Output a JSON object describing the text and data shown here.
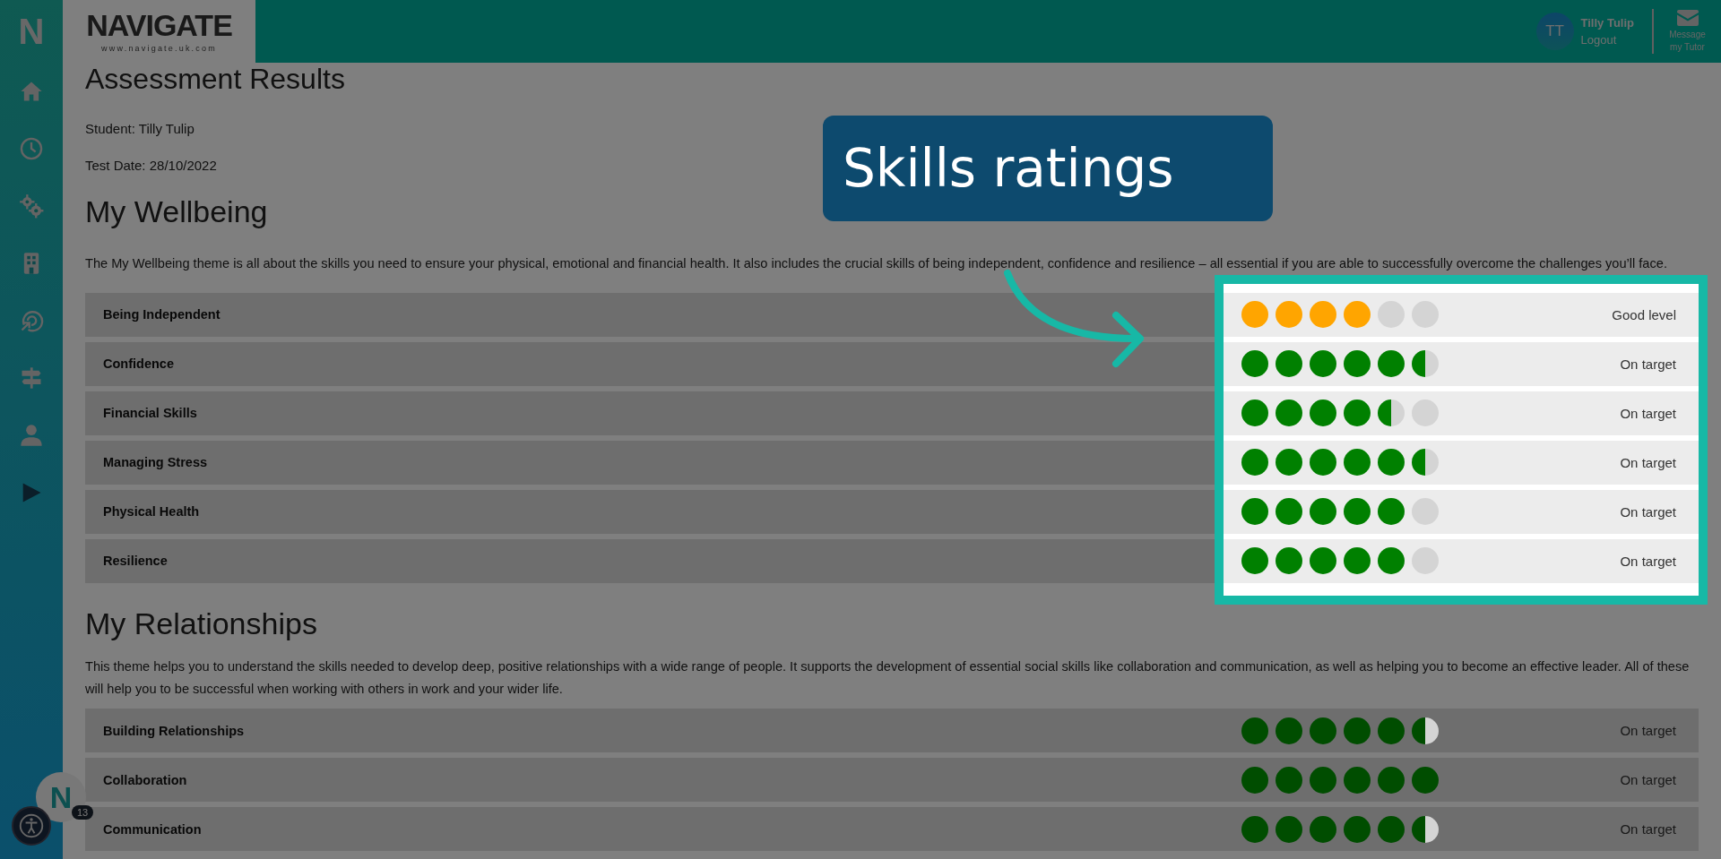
{
  "header": {
    "logo_mark": "N",
    "logo": "NAVIGATE",
    "logo_url": "www.navigate.uk.com",
    "user": {
      "initials": "TT",
      "name": "Tilly Tulip",
      "logout": "Logout"
    },
    "message_button": "Message my Tutor"
  },
  "page": {
    "title": "Assessment Results",
    "student": "Student: Tilly Tulip",
    "test_date": "Test Date: 28/10/2022"
  },
  "sections": [
    {
      "title": "My Wellbeing",
      "description": "The My Wellbeing theme is all about the skills you need to ensure your physical, emotional and financial health. It also includes the crucial skills of being independent, confidence and resilience – all essential if you are able to successfully overcome the challenges you’ll face.",
      "highlighted": true,
      "skills": [
        {
          "name": "Being Independent",
          "stars": 4,
          "color": "#ffa500",
          "status": "Good level"
        },
        {
          "name": "Confidence",
          "stars": 5.5,
          "color": "#008000",
          "status": "On target"
        },
        {
          "name": "Financial Skills",
          "stars": 4.5,
          "color": "#008000",
          "status": "On target"
        },
        {
          "name": "Managing Stress",
          "stars": 5.5,
          "color": "#008000",
          "status": "On target"
        },
        {
          "name": "Physical Health",
          "stars": 5,
          "color": "#008000",
          "status": "On target"
        },
        {
          "name": "Resilience",
          "stars": 5,
          "color": "#008000",
          "status": "On target"
        }
      ]
    },
    {
      "title": "My Relationships",
      "description": "This theme helps you to understand the skills needed to develop deep, positive relationships with a wide range of people. It supports the development of essential social skills like collaboration and communication, as well as helping you to become an effective leader. All of these will help you to be successful when working with others in work and your wider life.",
      "highlighted": false,
      "skills": [
        {
          "name": "Building Relationships",
          "stars": 5.5,
          "color": "#004d00",
          "status": "On target"
        },
        {
          "name": "Collaboration",
          "stars": 6,
          "color": "#004d00",
          "status": "On target"
        },
        {
          "name": "Communication",
          "stars": 5.5,
          "color": "#004d00",
          "status": "On target"
        }
      ]
    }
  ],
  "callout": {
    "text": "Skills ratings"
  },
  "chat": {
    "letter": "N",
    "count": "13"
  }
}
